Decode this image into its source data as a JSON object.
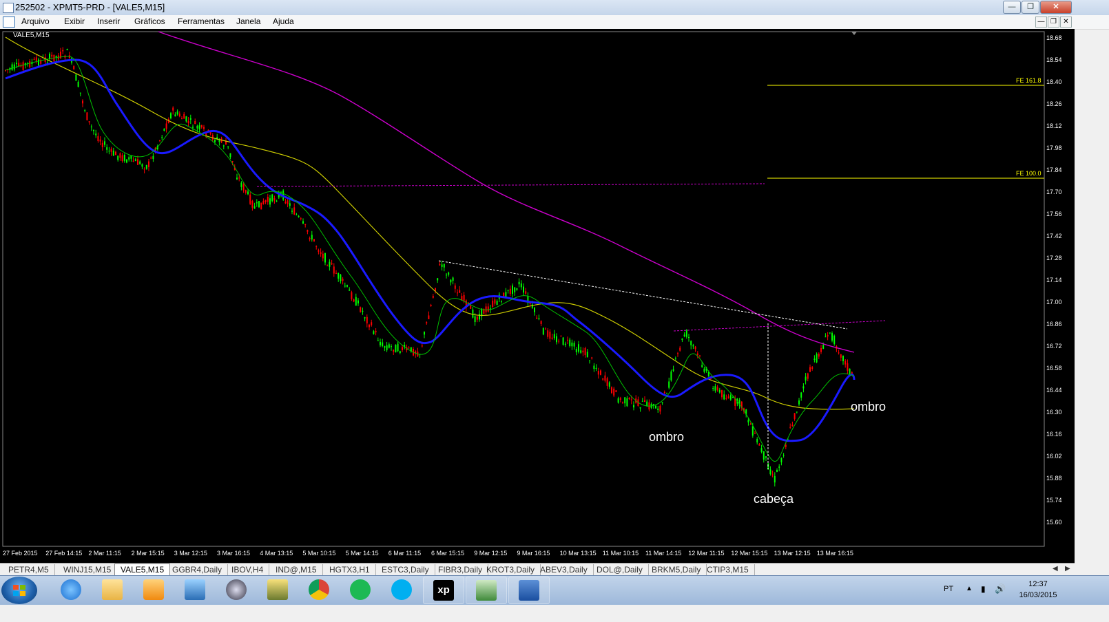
{
  "window": {
    "title": "252502 - XPMT5-PRD - [VALE5,M15]",
    "controls": [
      "minimize",
      "restore",
      "close"
    ]
  },
  "menu": {
    "items": [
      "Arquivo",
      "Exibir",
      "Inserir",
      "Gráficos",
      "Ferramentas",
      "Janela",
      "Ajuda"
    ]
  },
  "chart": {
    "symbol_label": "VALE5,M15",
    "y_ticks": [
      "18.68",
      "18.54",
      "18.40",
      "18.26",
      "18.12",
      "17.98",
      "17.84",
      "17.70",
      "17.56",
      "17.42",
      "17.28",
      "17.14",
      "17.00",
      "16.86",
      "16.72",
      "16.58",
      "16.44",
      "16.30",
      "16.16",
      "16.02",
      "15.88",
      "15.74",
      "15.60"
    ],
    "x_ticks": [
      "27 Feb 2015",
      "27 Feb 14:15",
      "2 Mar 11:15",
      "2 Mar 15:15",
      "3 Mar 12:15",
      "3 Mar 16:15",
      "4 Mar 13:15",
      "5 Mar 10:15",
      "5 Mar 14:15",
      "6 Mar 11:15",
      "6 Mar 15:15",
      "9 Mar 12:15",
      "9 Mar 16:15",
      "10 Mar 13:15",
      "11 Mar 10:15",
      "11 Mar 14:15",
      "12 Mar 11:15",
      "12 Mar 15:15",
      "13 Mar 12:15",
      "13 Mar 16:15"
    ],
    "fibo_labels": [
      "FE 161.8",
      "FE 100.0"
    ],
    "annotations": {
      "left_shoulder": "ombro",
      "head": "cabeça",
      "right_shoulder": "ombro"
    },
    "colors": {
      "background": "#000000",
      "candle_up": "#00ff00",
      "candle_down": "#ff0000",
      "ma_fast": "#00c000",
      "ma_mid": "#0000ff",
      "ma_slow": "#cccc00",
      "ma_long": "#cc00cc",
      "fibo": "#ffff00",
      "resistance": "#cc00cc",
      "trendline": "#ffffff"
    }
  },
  "tabs": {
    "items": [
      "PETR4,M5",
      "WINJ15,M15",
      "VALE5,M15",
      "GGBR4,Daily",
      "IBOV,H4",
      "IND@,M15",
      "HGTX3,H1",
      "ESTC3,Daily",
      "FIBR3,Daily",
      "KROT3,Daily",
      "ABEV3,Daily",
      "DOL@,Daily",
      "BRKM5,Daily",
      "CTIP3,M15"
    ],
    "active": "VALE5,M15"
  },
  "taskbar": {
    "apps": [
      "internet-explorer",
      "file-explorer",
      "media-player",
      "remote-app",
      "hp-app",
      "tool-app",
      "chrome",
      "spotify",
      "skype",
      "xp-investimentos",
      "metatrader",
      "word"
    ],
    "xp_label": "xp",
    "language": "PT",
    "time": "12:37",
    "date": "16/03/2015"
  }
}
